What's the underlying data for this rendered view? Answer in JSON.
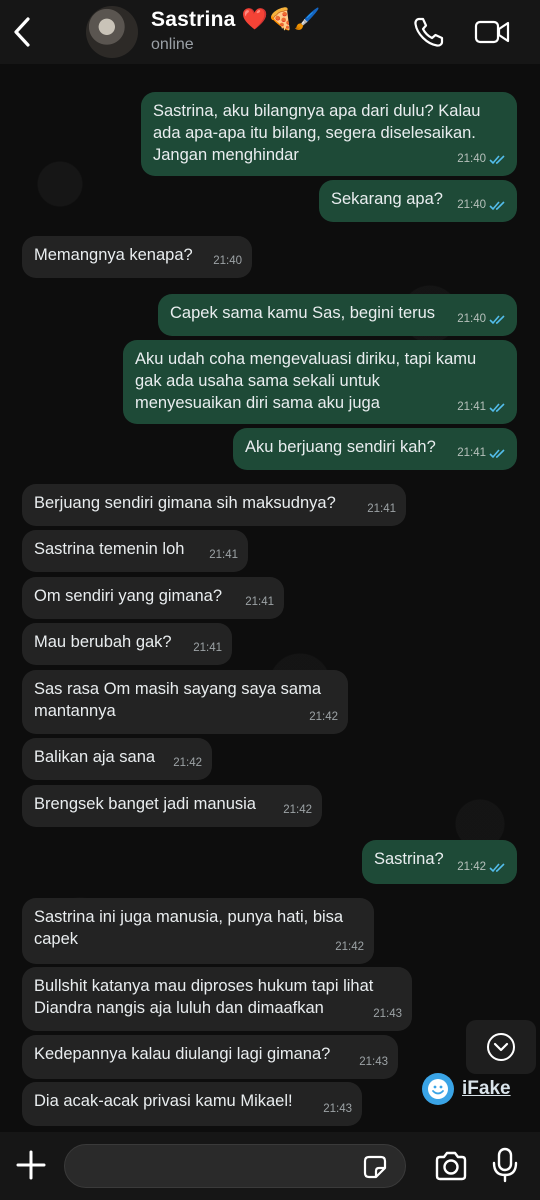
{
  "header": {
    "contact_name": "Sastrina ❤️🍕🖌️",
    "status": "online"
  },
  "colors": {
    "outgoing_bubble": "#1e4a37",
    "incoming_bubble": "#232323",
    "read_ticks": "#53bdeb",
    "ifake_icon": "#3aa4e6"
  },
  "messages": [
    {
      "dir": "out",
      "text": "Sastrina, aku bilangnya apa dari dulu? Kalau\nada apa-apa itu bilang, segera diselesaikan.\nJangan menghindar",
      "time": "21:40",
      "read": true
    },
    {
      "dir": "out",
      "text": "Sekarang apa?",
      "time": "21:40",
      "read": true
    },
    {
      "dir": "in",
      "text": "Memangnya kenapa?",
      "time": "21:40"
    },
    {
      "dir": "out",
      "text": "Capek sama kamu Sas, begini terus",
      "time": "21:40",
      "read": true
    },
    {
      "dir": "out",
      "text": "Aku udah coha mengevaluasi diriku, tapi kamu\ngak ada usaha sama sekali untuk\nmenyesuaikan diri sama aku juga",
      "time": "21:41",
      "read": true
    },
    {
      "dir": "out",
      "text": "Aku berjuang sendiri kah?",
      "time": "21:41",
      "read": true
    },
    {
      "dir": "in",
      "text": "Berjuang sendiri gimana sih maksudnya?",
      "time": "21:41"
    },
    {
      "dir": "in",
      "text": "Sastrina temenin loh",
      "time": "21:41"
    },
    {
      "dir": "in",
      "text": "Om sendiri yang gimana?",
      "time": "21:41"
    },
    {
      "dir": "in",
      "text": "Mau berubah gak?",
      "time": "21:41"
    },
    {
      "dir": "in",
      "text": "Sas rasa Om masih sayang saya sama\nmantannya",
      "time": "21:42"
    },
    {
      "dir": "in",
      "text": "Balikan aja sana",
      "time": "21:42"
    },
    {
      "dir": "in",
      "text": "Brengsek banget jadi manusia",
      "time": "21:42"
    },
    {
      "dir": "out",
      "text": "Sastrina?",
      "time": "21:42",
      "read": true
    },
    {
      "dir": "in",
      "text": "Sastrina ini juga manusia, punya hati, bisa\ncapek",
      "time": "21:42"
    },
    {
      "dir": "in",
      "text": "Bullshit katanya mau diproses hukum tapi lihat\nDiandra nangis aja luluh dan dimaafkan",
      "time": "21:43"
    },
    {
      "dir": "in",
      "text": "Kedepannya kalau diulangi lagi gimana?",
      "time": "21:43"
    },
    {
      "dir": "in",
      "text": "Dia acak-acak privasi kamu Mikael!",
      "time": "21:43"
    }
  ],
  "watermark": {
    "label": "iFake",
    "icon": "smiley-icon"
  },
  "icons": {
    "back": "chevron-left-icon",
    "call": "phone-icon",
    "video": "video-camera-icon",
    "scroll": "chevron-down-circle-icon",
    "attach": "plus-icon",
    "sticker": "sticker-icon",
    "camera": "camera-icon",
    "mic": "microphone-icon"
  }
}
